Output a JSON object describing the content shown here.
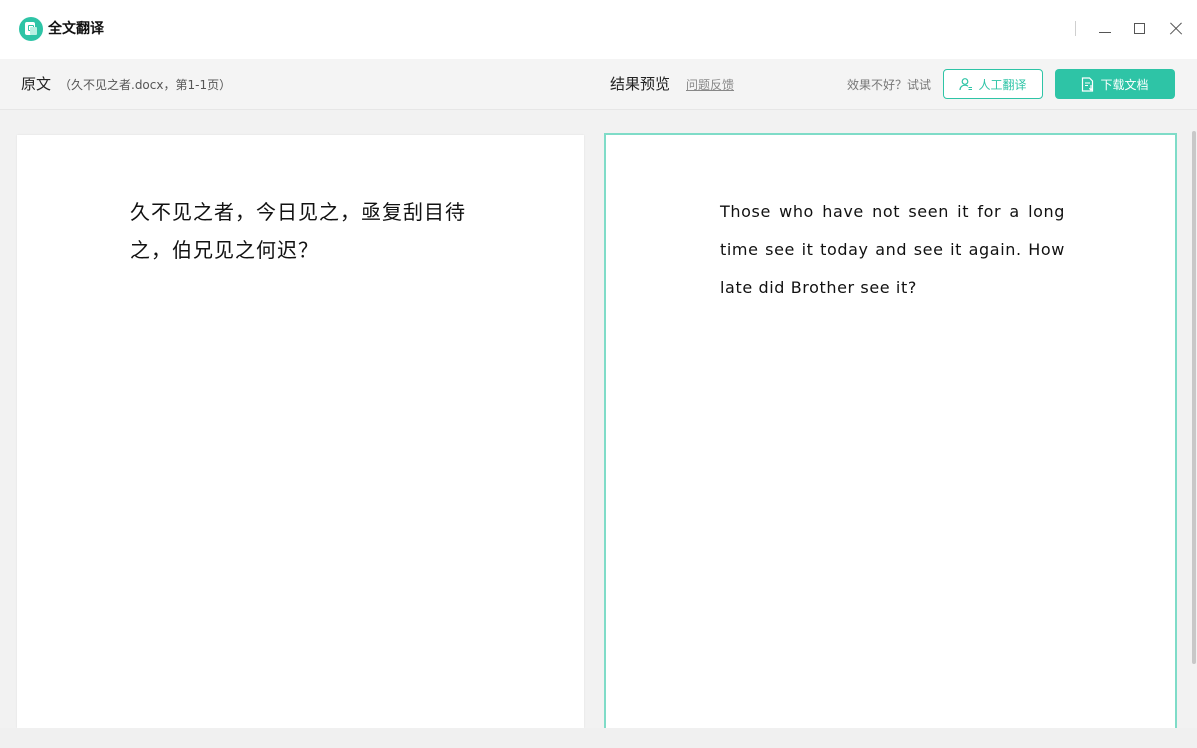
{
  "app": {
    "title": "全文翻译",
    "logo_icon": "translate-doc-icon"
  },
  "window_controls": [
    "minimize-icon",
    "maximize-icon",
    "close-icon"
  ],
  "toolbar": {
    "source_label": "原文",
    "source_info": "（久不见之者.docx，第1-1页）",
    "preview_label": "结果预览",
    "feedback_link": "问题反馈",
    "hint": "效果不好？试试",
    "human_translate_label": "人工翻译",
    "download_label": "下载文档"
  },
  "source_panel": {
    "text": "久不见之者，今日见之，亟复刮目待之，伯兄见之何迟？"
  },
  "preview_panel": {
    "text": "Those who have not seen it for a long time see it today and see it again. How late did Brother see it?"
  },
  "colors": {
    "accent": "#2ec4a6",
    "preview_border": "#7fdcc8",
    "background": "#f2f2f2"
  }
}
